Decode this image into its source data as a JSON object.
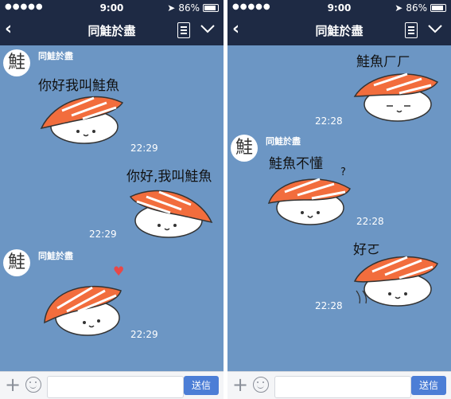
{
  "status": {
    "carrier_dots": "●●●●●",
    "time": "9:00",
    "battery": "86%",
    "battery_level": 0.86
  },
  "nav": {
    "back_glyph": "‹",
    "title": "同鮭於盡"
  },
  "input": {
    "placeholder": "",
    "send_label": "送信"
  },
  "left": {
    "messages": [
      {
        "sender": "同鮭於盡",
        "avatar_char": "鮭",
        "sticker_text": "你好我叫鮭魚",
        "time": "22:29"
      },
      {
        "sticker_text": "你好,我叫鮭魚",
        "time": "22:29"
      },
      {
        "sender": "同鮭於盡",
        "avatar_char": "鮭",
        "heart": "♥",
        "time": "22:29"
      }
    ]
  },
  "right": {
    "messages": [
      {
        "sticker_text": "鮭魚ㄏㄏ",
        "time": "22:28"
      },
      {
        "sender": "同鮭於盡",
        "avatar_char": "鮭",
        "sticker_text": "鮭魚不懂",
        "question": "?",
        "time": "22:28"
      },
      {
        "sticker_text": "好ㄛ",
        "time": "22:28"
      }
    ]
  },
  "colors": {
    "bar": "#1e2a44",
    "chat_bg": "#6c96c4",
    "salmon": "#f26d3d",
    "send": "#4c7ed6"
  }
}
